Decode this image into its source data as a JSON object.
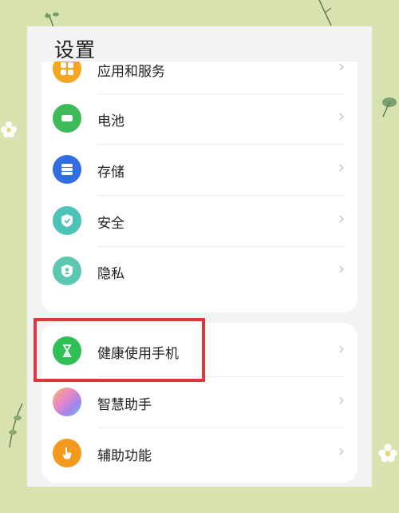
{
  "settings": {
    "title": "设置",
    "group1": [
      {
        "label": "应用和服务",
        "icon": "apps-icon",
        "color": "#f5a623"
      },
      {
        "label": "电池",
        "icon": "battery-icon",
        "color": "#3dbb58"
      },
      {
        "label": "存储",
        "icon": "storage-icon",
        "color": "#2f6de0"
      },
      {
        "label": "安全",
        "icon": "shield-icon",
        "color": "#4cc3b7"
      },
      {
        "label": "隐私",
        "icon": "privacy-icon",
        "color": "#5cc8b2"
      }
    ],
    "group2": [
      {
        "label": "健康使用手机",
        "icon": "hourglass-icon",
        "color": "#2fbf55"
      },
      {
        "label": "智慧助手",
        "icon": "assistant-icon",
        "color": "#b08de8"
      },
      {
        "label": "辅助功能",
        "icon": "hand-icon",
        "color": "#f3991d"
      }
    ],
    "chevron": "›"
  },
  "colors": {
    "background": "#d8e3b0",
    "highlight": "#e0353b"
  }
}
